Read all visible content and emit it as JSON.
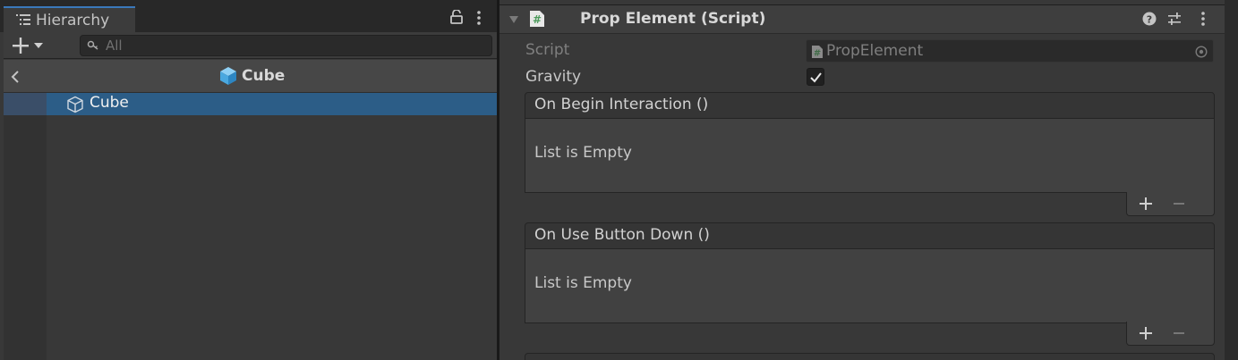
{
  "hierarchy": {
    "tab_label": "Hierarchy",
    "search_placeholder": "All",
    "scene_title": "Cube",
    "rows": [
      {
        "label": "Cube",
        "selected": true
      }
    ]
  },
  "inspector": {
    "component_title": "Prop Element (Script)",
    "script_label": "Script",
    "script_value": "PropElement",
    "gravity_label": "Gravity",
    "gravity_checked": true,
    "events": [
      {
        "title": "On Begin Interaction ()",
        "empty_text": "List is Empty"
      },
      {
        "title": "On Use Button Down ()",
        "empty_text": "List is Empty"
      }
    ]
  },
  "colors": {
    "selection": "#2c5d87",
    "tab_accent": "#3a79bb",
    "cube_icon": "#5ab4e8",
    "script_icon": "#4c9a5b"
  },
  "icons": [
    "hierarchy-icon",
    "lock-icon",
    "menu-dots-icon",
    "plus-icon",
    "dropdown-arrow-icon",
    "search-icon",
    "back-arrow-icon",
    "cube-icon",
    "foldout-arrow-icon",
    "script-icon",
    "help-icon",
    "preset-icon",
    "object-picker-icon",
    "checkmark-icon",
    "minus-icon"
  ]
}
